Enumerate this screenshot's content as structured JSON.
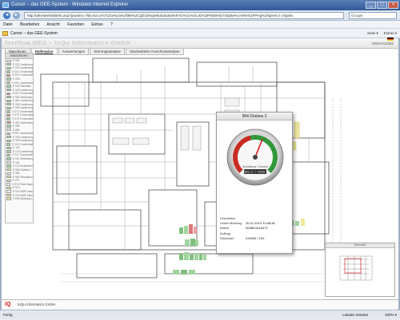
{
  "window": {
    "title": "Cursor – das GEE-System - Windows Internet Explorer",
    "controls": {
      "minimize": "_",
      "maximize": "□",
      "close": "×"
    }
  },
  "address": {
    "back": "◄",
    "forward": "►",
    "url": "http://devsteel45/Breh.asp?params=?ldv.ed=ci%7Cinv%2a%2fi68%2Cgl2ctrhvgH6oboluted%FAG%ir1%GLtG%2PHEB%E7c8p5e%cH0%%2FPHg%2Ng%Kcr=Vtgshv",
    "search_placeholder": "Google"
  },
  "menu": [
    "Datei",
    "Bearbeiten",
    "Ansicht",
    "Favoriten",
    "Extras",
    "?"
  ],
  "favbar": {
    "tab_title": "Cursor – das GEE-System",
    "commands": [
      "Seite ▾",
      "Extras ▾"
    ]
  },
  "app": {
    "logo_text": "fastflow.MES – InQu Informatics GmbH",
    "user_link": "EMSACD262"
  },
  "tabs": [
    {
      "label": "Maschinen",
      "active": false
    },
    {
      "label": "Hallenplan",
      "active": true
    },
    {
      "label": "Auswertungen",
      "active": false
    },
    {
      "label": "Störungsanalyse",
      "active": false
    },
    {
      "label": "Stacharbeits-/Auschussanalyse",
      "active": false
    }
  ],
  "sidebar": {
    "header": "Maschinen",
    "items": [
      {
        "label": "E 001",
        "color": "#ffffff"
      },
      {
        "label": "E 021 Lackierung",
        "color": "#9fd49f"
      },
      {
        "label": "E 022 Lackierung",
        "color": "#9fd49f"
      },
      {
        "label": "E 031 Trockenkabine",
        "color": "#9fd49f"
      },
      {
        "label": "E 032 Trockenkabine",
        "color": "#d97a7a"
      },
      {
        "label": "E 033",
        "color": "#9fd49f"
      },
      {
        "label": "E 041 Laserschweißen",
        "color": "#9fd49f"
      },
      {
        "label": "E 042 Schleifen",
        "color": "#9fd49f"
      },
      {
        "label": "E 043 Lackierung",
        "color": "#9fd49f"
      },
      {
        "label": "E 051 Trockenkabine",
        "color": "#d97a7a"
      },
      {
        "label": "E 052 Verbindung",
        "color": "#9fd49f"
      },
      {
        "label": "E 061 Lackierung",
        "color": "#9fd49f"
      },
      {
        "label": "E 062 Lackierung",
        "color": "#9fd49f"
      },
      {
        "label": "E 063 Lackierung",
        "color": "#9fd49f"
      },
      {
        "label": "E 071 Trockenkabine",
        "color": "#9fd49f"
      },
      {
        "label": "E 072 Trockenkabine",
        "color": "#d97a7a"
      },
      {
        "label": "E 073 Trockenkabine",
        "color": "#9fd49f"
      },
      {
        "label": "E 081 Verbindung",
        "color": "#d97a7a"
      },
      {
        "label": "E 082",
        "color": "#9fd49f"
      },
      {
        "label": "E 083",
        "color": "#ffffff"
      },
      {
        "label": "E 091 Laserschweißen",
        "color": "#9fd49f"
      },
      {
        "label": "E 092 Lackierung",
        "color": "#9fd49f"
      },
      {
        "label": "E 093 Lackierung",
        "color": "#9fd49f"
      },
      {
        "label": "E 101 Trockenkabine",
        "color": "#9fd49f"
      },
      {
        "label": "E 102",
        "color": "#9fd49f"
      },
      {
        "label": "E 103 Lackierung",
        "color": "#9fd49f"
      },
      {
        "label": "E 111 Trockenkabine",
        "color": "#9fd49f"
      },
      {
        "label": "E 112 Verbindung",
        "color": "#9fd49f"
      },
      {
        "label": "E 121",
        "color": "#ffffff"
      },
      {
        "label": "E 131 Endkontrolle",
        "color": "#9fd49f"
      },
      {
        "label": "E 954 Dünkes 2",
        "color": "#eee89a"
      },
      {
        "label": "E 961",
        "color": "#ffffff"
      },
      {
        "label": "E 962 Verpackung",
        "color": "#eee89a"
      },
      {
        "label": "E 971",
        "color": "#eee89a"
      },
      {
        "label": "E 972 Final Inspection",
        "color": "#ffffff"
      },
      {
        "label": "E 973",
        "color": "#eee89a"
      },
      {
        "label": "E 974 SWP unten",
        "color": "#ffffff"
      },
      {
        "label": "E 975 SWP oben",
        "color": "#eee89a"
      },
      {
        "label": "E 976 Senkung Lin",
        "color": "#eee89a"
      }
    ]
  },
  "popup": {
    "title": "954 Dünkes 2",
    "gauge_value": 0.58,
    "gauge_caption": "Auslastung / Gesamt",
    "gauge_readout": "0062.3 / 0106.4",
    "details": [
      {
        "key": "Produktion",
        "value": ""
      },
      {
        "key": "Letzte Meldung",
        "value": "20.01.2010 13:48:36"
      },
      {
        "key": "Artikel",
        "value": "004BG4110072"
      },
      {
        "key": "Auftrag",
        "value": ""
      },
      {
        "key": "Stückzahl",
        "value": "310006 / 100"
      }
    ]
  },
  "minimap": {
    "header": "Übersicht"
  },
  "footer": {
    "logo": "iQ",
    "text": "InQu Informatics GmbH"
  },
  "statusbar": {
    "left": "Fertig",
    "zone": "Lokales Intranet",
    "zoom": "100% ▾"
  }
}
